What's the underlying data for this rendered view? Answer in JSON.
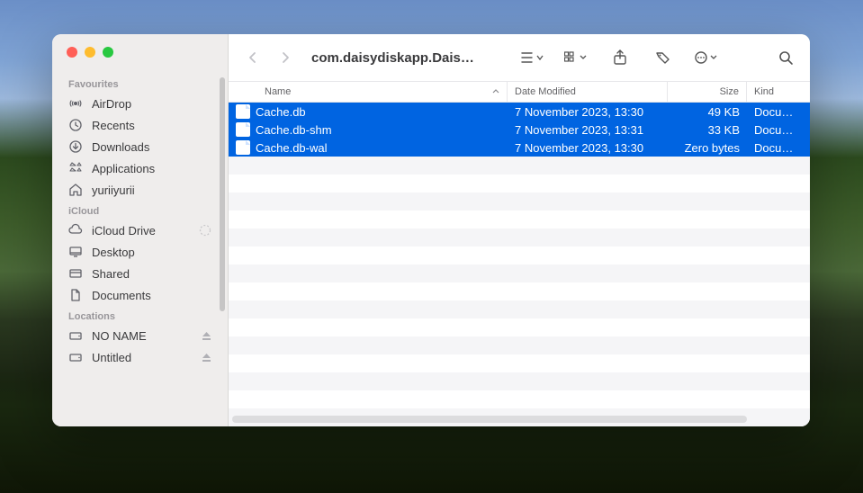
{
  "window": {
    "title": "com.daisydiskapp.Daisy…"
  },
  "sidebar": {
    "sections": [
      {
        "header": "Favourites",
        "items": [
          {
            "icon": "airdrop",
            "label": "AirDrop"
          },
          {
            "icon": "clock",
            "label": "Recents"
          },
          {
            "icon": "download",
            "label": "Downloads"
          },
          {
            "icon": "grid",
            "label": "Applications"
          },
          {
            "icon": "house",
            "label": "yuriiyurii"
          }
        ]
      },
      {
        "header": "iCloud",
        "items": [
          {
            "icon": "cloud",
            "label": "iCloud Drive",
            "extra": "progress"
          },
          {
            "icon": "desktop",
            "label": "Desktop"
          },
          {
            "icon": "shared",
            "label": "Shared"
          },
          {
            "icon": "doc",
            "label": "Documents"
          }
        ]
      },
      {
        "header": "Locations",
        "items": [
          {
            "icon": "drive",
            "label": "NO NAME",
            "extra": "eject"
          },
          {
            "icon": "drive",
            "label": "Untitled",
            "extra": "eject"
          }
        ]
      }
    ]
  },
  "columns": {
    "name": "Name",
    "date": "Date Modified",
    "size": "Size",
    "kind": "Kind"
  },
  "files": [
    {
      "name": "Cache.db",
      "date": "7 November 2023, 13:30",
      "size": "49 KB",
      "kind": "Document",
      "selected": true
    },
    {
      "name": "Cache.db-shm",
      "date": "7 November 2023, 13:31",
      "size": "33 KB",
      "kind": "Document",
      "selected": true
    },
    {
      "name": "Cache.db-wal",
      "date": "7 November 2023, 13:30",
      "size": "Zero bytes",
      "kind": "Document",
      "selected": true
    }
  ]
}
